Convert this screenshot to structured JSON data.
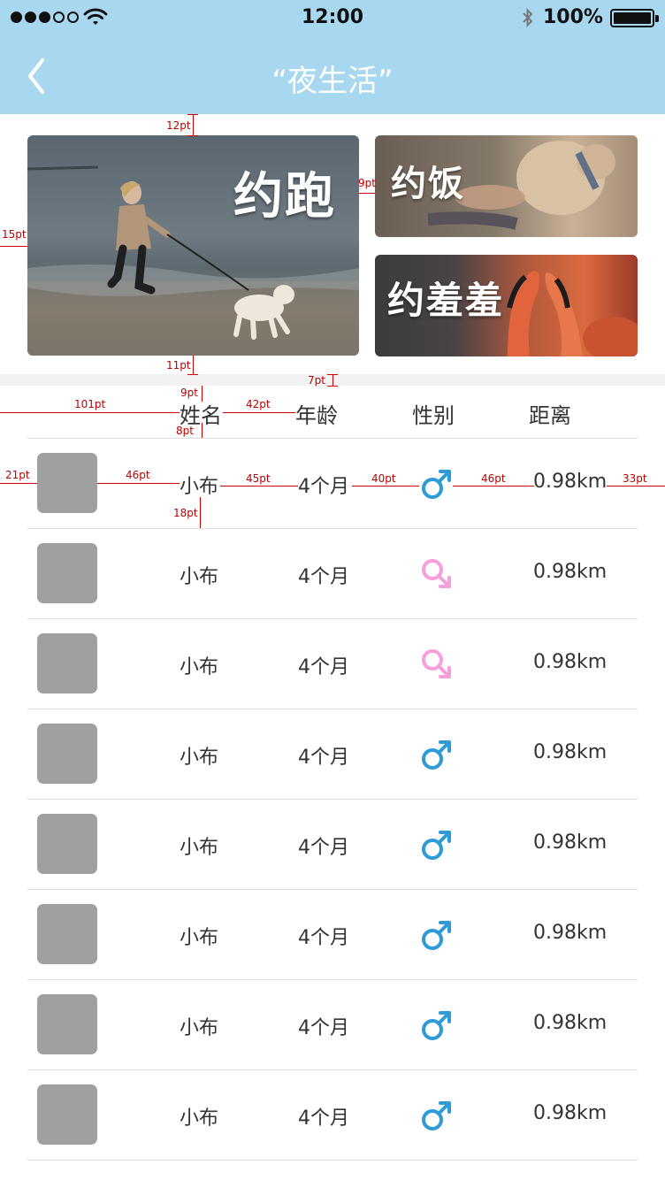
{
  "status_bar": {
    "time": "12:00",
    "battery": "100%",
    "signal_strength": 3,
    "signal_total": 5
  },
  "nav": {
    "title": "“夜生活”"
  },
  "banners": {
    "run": "约跑",
    "eat": "约饭",
    "shy": "约羞羞"
  },
  "table": {
    "headers": [
      "姓名",
      "年龄",
      "性别",
      "距离"
    ],
    "rows": [
      {
        "name": "小布",
        "age": "4个月",
        "gender": "male",
        "distance": "0.98km"
      },
      {
        "name": "小布",
        "age": "4个月",
        "gender": "female",
        "distance": "0.98km"
      },
      {
        "name": "小布",
        "age": "4个月",
        "gender": "female",
        "distance": "0.98km"
      },
      {
        "name": "小布",
        "age": "4个月",
        "gender": "male",
        "distance": "0.98km"
      },
      {
        "name": "小布",
        "age": "4个月",
        "gender": "male",
        "distance": "0.98km"
      },
      {
        "name": "小布",
        "age": "4个月",
        "gender": "male",
        "distance": "0.98km"
      },
      {
        "name": "小布",
        "age": "4个月",
        "gender": "male",
        "distance": "0.98km"
      },
      {
        "name": "小布",
        "age": "4个月",
        "gender": "male",
        "distance": "0.98km"
      }
    ]
  },
  "annotations": {
    "a1": "12pt",
    "a2": "9pt",
    "a3": "15pt",
    "a4": "11pt",
    "a5": "7pt",
    "a6": "9pt",
    "a7": "101pt",
    "a8": "42pt",
    "a9": "8pt",
    "a10": "21pt",
    "a11": "46pt",
    "a12": "45pt",
    "a13": "40pt",
    "a14": "46pt",
    "a15": "33pt",
    "a16": "18pt"
  },
  "colors": {
    "header_bg": "#a8d8f0",
    "male": "#2e9ad6",
    "female": "#f5a0dc",
    "avatar": "#a0a0a0",
    "annotation": "#c00000"
  },
  "icons": {
    "back": "chevron-left-icon",
    "male": "male-symbol-icon",
    "female": "female-symbol-icon"
  }
}
